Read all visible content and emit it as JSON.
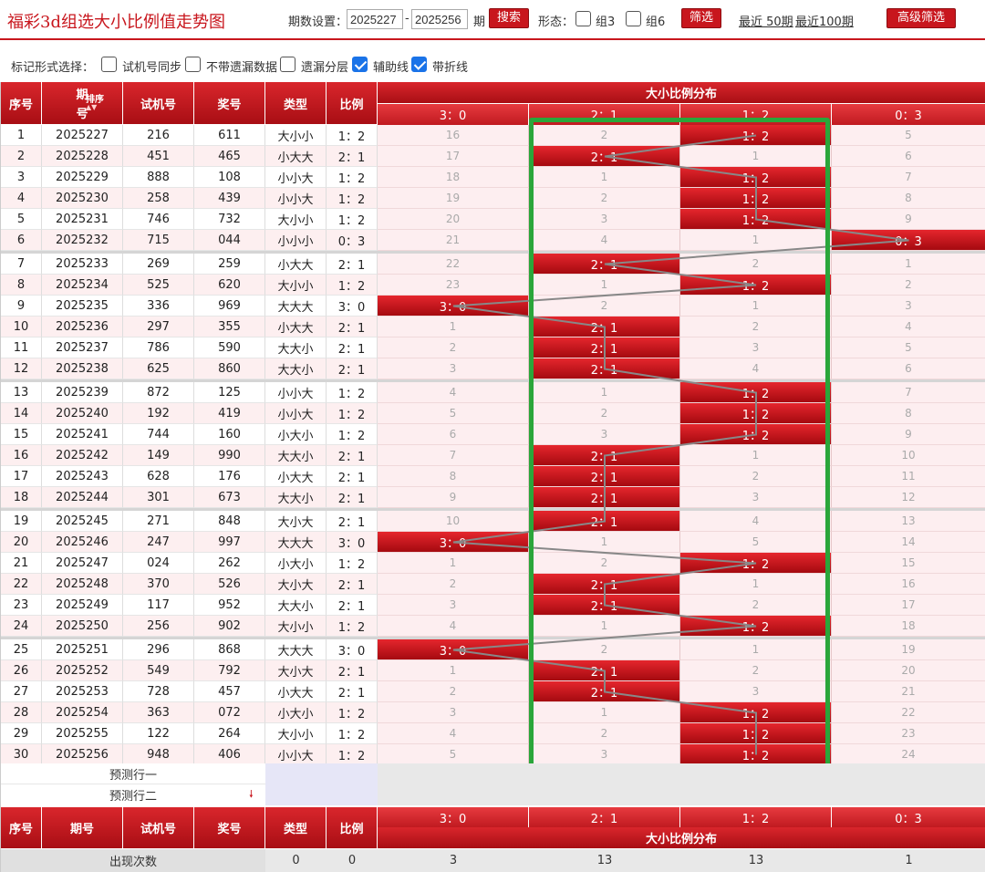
{
  "title": "福彩3d组选大小比例值走势图",
  "toolbar": {
    "period_label": "期数设置：",
    "start": "2025227",
    "dash": "-",
    "end": "2025256",
    "qi": "期",
    "search": "搜索",
    "form_label": "形态：",
    "z3": "组3",
    "z6": "组6",
    "filter": "筛选",
    "recent50": "最近 50期",
    "recent100": "最近100期",
    "advanced": "高级筛选"
  },
  "mark": {
    "label": "标记形式选择：",
    "options": [
      {
        "label": "试机号同步",
        "checked": false
      },
      {
        "label": "不带遗漏数据",
        "checked": false
      },
      {
        "label": "遗漏分层",
        "checked": false
      },
      {
        "label": "辅助线",
        "checked": true
      },
      {
        "label": "带折线",
        "checked": true
      }
    ]
  },
  "headers": {
    "seq": "序号",
    "period_a": "期",
    "period_b": "号",
    "sort": "排序",
    "test": "试机号",
    "win": "奖号",
    "type": "类型",
    "ratio": "比例",
    "dist": "大小比例分布",
    "cats": [
      "3：0",
      "2：1",
      "1：2",
      "0：3"
    ],
    "period": "期号"
  },
  "rows": [
    {
      "seq": "1",
      "period": "2025227",
      "test": "216",
      "win": "611",
      "type": "大小小",
      "ratio": "1：2",
      "hit": 2,
      "vals": [
        "16",
        "2",
        "1：2",
        "5"
      ]
    },
    {
      "seq": "2",
      "period": "2025228",
      "test": "451",
      "win": "465",
      "type": "小大大",
      "ratio": "2：1",
      "hit": 1,
      "vals": [
        "17",
        "2：1",
        "1",
        "6"
      ]
    },
    {
      "seq": "3",
      "period": "2025229",
      "test": "888",
      "win": "108",
      "type": "小小大",
      "ratio": "1：2",
      "hit": 2,
      "vals": [
        "18",
        "1",
        "1：2",
        "7"
      ]
    },
    {
      "seq": "4",
      "period": "2025230",
      "test": "258",
      "win": "439",
      "type": "小小大",
      "ratio": "1：2",
      "hit": 2,
      "vals": [
        "19",
        "2",
        "1：2",
        "8"
      ]
    },
    {
      "seq": "5",
      "period": "2025231",
      "test": "746",
      "win": "732",
      "type": "大小小",
      "ratio": "1：2",
      "hit": 2,
      "vals": [
        "20",
        "3",
        "1：2",
        "9"
      ]
    },
    {
      "seq": "6",
      "period": "2025232",
      "test": "715",
      "win": "044",
      "type": "小小小",
      "ratio": "0：3",
      "hit": 3,
      "vals": [
        "21",
        "4",
        "1",
        "0：3"
      ]
    },
    {
      "seq": "7",
      "period": "2025233",
      "test": "269",
      "win": "259",
      "type": "小大大",
      "ratio": "2：1",
      "hit": 1,
      "vals": [
        "22",
        "2：1",
        "2",
        "1"
      ]
    },
    {
      "seq": "8",
      "period": "2025234",
      "test": "525",
      "win": "620",
      "type": "大小小",
      "ratio": "1：2",
      "hit": 2,
      "vals": [
        "23",
        "1",
        "1：2",
        "2"
      ]
    },
    {
      "seq": "9",
      "period": "2025235",
      "test": "336",
      "win": "969",
      "type": "大大大",
      "ratio": "3：0",
      "hit": 0,
      "vals": [
        "3：0",
        "2",
        "1",
        "3"
      ]
    },
    {
      "seq": "10",
      "period": "2025236",
      "test": "297",
      "win": "355",
      "type": "小大大",
      "ratio": "2：1",
      "hit": 1,
      "vals": [
        "1",
        "2：1",
        "2",
        "4"
      ]
    },
    {
      "seq": "11",
      "period": "2025237",
      "test": "786",
      "win": "590",
      "type": "大大小",
      "ratio": "2：1",
      "hit": 1,
      "vals": [
        "2",
        "2：1",
        "3",
        "5"
      ]
    },
    {
      "seq": "12",
      "period": "2025238",
      "test": "625",
      "win": "860",
      "type": "大大小",
      "ratio": "2：1",
      "hit": 1,
      "vals": [
        "3",
        "2：1",
        "4",
        "6"
      ]
    },
    {
      "seq": "13",
      "period": "2025239",
      "test": "872",
      "win": "125",
      "type": "小小大",
      "ratio": "1：2",
      "hit": 2,
      "vals": [
        "4",
        "1",
        "1：2",
        "7"
      ]
    },
    {
      "seq": "14",
      "period": "2025240",
      "test": "192",
      "win": "419",
      "type": "小小大",
      "ratio": "1：2",
      "hit": 2,
      "vals": [
        "5",
        "2",
        "1：2",
        "8"
      ]
    },
    {
      "seq": "15",
      "period": "2025241",
      "test": "744",
      "win": "160",
      "type": "小大小",
      "ratio": "1：2",
      "hit": 2,
      "vals": [
        "6",
        "3",
        "1：2",
        "9"
      ]
    },
    {
      "seq": "16",
      "period": "2025242",
      "test": "149",
      "win": "990",
      "type": "大大小",
      "ratio": "2：1",
      "hit": 1,
      "vals": [
        "7",
        "2：1",
        "1",
        "10"
      ]
    },
    {
      "seq": "17",
      "period": "2025243",
      "test": "628",
      "win": "176",
      "type": "小大大",
      "ratio": "2：1",
      "hit": 1,
      "vals": [
        "8",
        "2：1",
        "2",
        "11"
      ]
    },
    {
      "seq": "18",
      "period": "2025244",
      "test": "301",
      "win": "673",
      "type": "大大小",
      "ratio": "2：1",
      "hit": 1,
      "vals": [
        "9",
        "2：1",
        "3",
        "12"
      ]
    },
    {
      "seq": "19",
      "period": "2025245",
      "test": "271",
      "win": "848",
      "type": "大小大",
      "ratio": "2：1",
      "hit": 1,
      "vals": [
        "10",
        "2：1",
        "4",
        "13"
      ]
    },
    {
      "seq": "20",
      "period": "2025246",
      "test": "247",
      "win": "997",
      "type": "大大大",
      "ratio": "3：0",
      "hit": 0,
      "vals": [
        "3：0",
        "1",
        "5",
        "14"
      ]
    },
    {
      "seq": "21",
      "period": "2025247",
      "test": "024",
      "win": "262",
      "type": "小大小",
      "ratio": "1：2",
      "hit": 2,
      "vals": [
        "1",
        "2",
        "1：2",
        "15"
      ]
    },
    {
      "seq": "22",
      "period": "2025248",
      "test": "370",
      "win": "526",
      "type": "大小大",
      "ratio": "2：1",
      "hit": 1,
      "vals": [
        "2",
        "2：1",
        "1",
        "16"
      ]
    },
    {
      "seq": "23",
      "period": "2025249",
      "test": "117",
      "win": "952",
      "type": "大大小",
      "ratio": "2：1",
      "hit": 1,
      "vals": [
        "3",
        "2：1",
        "2",
        "17"
      ]
    },
    {
      "seq": "24",
      "period": "2025250",
      "test": "256",
      "win": "902",
      "type": "大小小",
      "ratio": "1：2",
      "hit": 2,
      "vals": [
        "4",
        "1",
        "1：2",
        "18"
      ]
    },
    {
      "seq": "25",
      "period": "2025251",
      "test": "296",
      "win": "868",
      "type": "大大大",
      "ratio": "3：0",
      "hit": 0,
      "vals": [
        "3：0",
        "2",
        "1",
        "19"
      ]
    },
    {
      "seq": "26",
      "period": "2025252",
      "test": "549",
      "win": "792",
      "type": "大小大",
      "ratio": "2：1",
      "hit": 1,
      "vals": [
        "1",
        "2：1",
        "2",
        "20"
      ]
    },
    {
      "seq": "27",
      "period": "2025253",
      "test": "728",
      "win": "457",
      "type": "小大大",
      "ratio": "2：1",
      "hit": 1,
      "vals": [
        "2",
        "2：1",
        "3",
        "21"
      ]
    },
    {
      "seq": "28",
      "period": "2025254",
      "test": "363",
      "win": "072",
      "type": "小大小",
      "ratio": "1：2",
      "hit": 2,
      "vals": [
        "3",
        "1",
        "1：2",
        "22"
      ]
    },
    {
      "seq": "29",
      "period": "2025255",
      "test": "122",
      "win": "264",
      "type": "大小小",
      "ratio": "1：2",
      "hit": 2,
      "vals": [
        "4",
        "2",
        "1：2",
        "23"
      ]
    },
    {
      "seq": "30",
      "period": "2025256",
      "test": "948",
      "win": "406",
      "type": "小小大",
      "ratio": "1：2",
      "hit": 2,
      "vals": [
        "5",
        "3",
        "1：2",
        "24"
      ]
    }
  ],
  "predict": {
    "row1": "预测行一",
    "row2": "预测行二"
  },
  "footer": {
    "label": "出现次数",
    "type_count": "0",
    "ratio_count": "0",
    "counts": [
      "3",
      "13",
      "13",
      "1"
    ]
  }
}
